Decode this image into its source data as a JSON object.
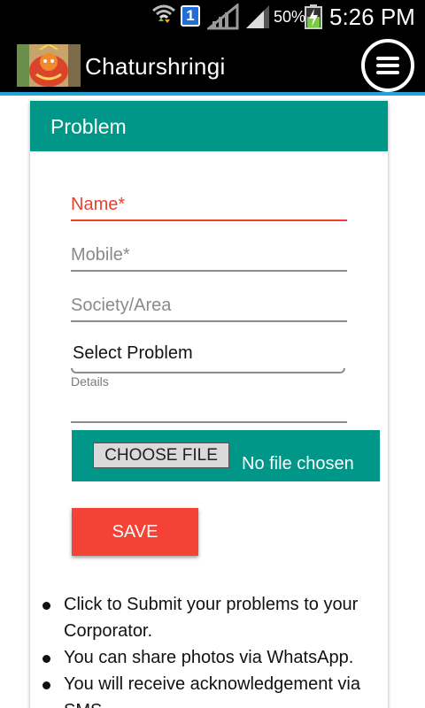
{
  "status_bar": {
    "sim_number": "1",
    "battery": "50%",
    "time": "5:26 PM"
  },
  "app": {
    "title": "Chaturshringi",
    "logo": "temple-deity-image",
    "menu_icon": "menu-icon"
  },
  "form": {
    "header": "Problem",
    "accent_color": "#009688",
    "error_color": "#e8412f",
    "fields": {
      "name_placeholder": "Name*",
      "mobile_placeholder": "Mobile*",
      "society_placeholder": "Society/Area",
      "problem_select": "Select Problem",
      "details_label": "Details"
    },
    "file": {
      "button_label": "CHOOSE FILE",
      "status": "No file chosen"
    },
    "save_label": "SAVE"
  },
  "notes": [
    "Click to Submit your problems to your Corporator.",
    "You can share photos via WhatsApp.",
    "You will receive acknowledgement via SMS."
  ]
}
